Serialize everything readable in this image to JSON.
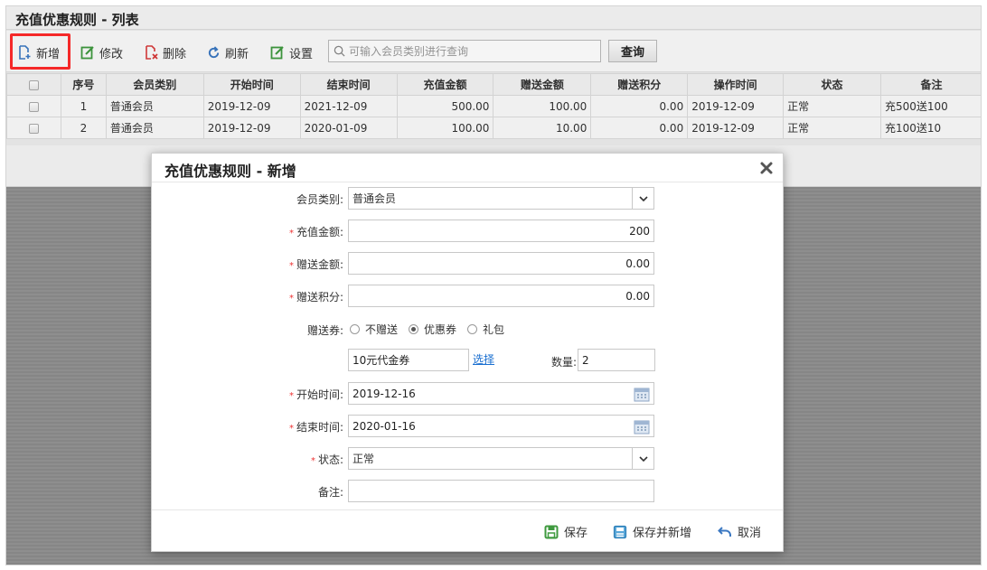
{
  "page_title": "充值优惠规则 - 列表",
  "toolbar": {
    "add_label": "新增",
    "edit_label": "修改",
    "delete_label": "删除",
    "refresh_label": "刷新",
    "settings_label": "设置",
    "search_placeholder": "可输入会员类别进行查询",
    "query_label": "查询"
  },
  "table": {
    "columns": [
      "序号",
      "会员类别",
      "开始时间",
      "结束时间",
      "充值金额",
      "赠送金额",
      "赠送积分",
      "操作时间",
      "状态",
      "备注"
    ],
    "rows": [
      [
        "1",
        "普通会员",
        "2019-12-09",
        "2021-12-09",
        "500.00",
        "100.00",
        "0.00",
        "2019-12-09",
        "正常",
        "充500送100"
      ],
      [
        "2",
        "普通会员",
        "2019-12-09",
        "2020-01-09",
        "100.00",
        "10.00",
        "0.00",
        "2019-12-09",
        "正常",
        "充100送10"
      ]
    ]
  },
  "dialog": {
    "title": "充值优惠规则 - 新增",
    "member_type_label": "会员类别:",
    "member_type_value": "普通会员",
    "recharge_label": "充值金额:",
    "recharge_value": "200",
    "gift_amount_label": "赠送金额:",
    "gift_amount_value": "0.00",
    "gift_points_label": "赠送积分:",
    "gift_points_value": "0.00",
    "gift_coupon_label": "赠送券:",
    "radio_none": "不赠送",
    "radio_coupon": "优惠券",
    "radio_gift": "礼包",
    "coupon_value": "10元代金券",
    "choose_label": "选择",
    "quantity_label": "数量:",
    "quantity_value": "2",
    "start_label": "开始时间:",
    "start_value": "2019-12-16",
    "end_label": "结束时间:",
    "end_value": "2020-01-16",
    "status_label": "状态:",
    "status_value": "正常",
    "remark_label": "备注:",
    "remark_value": "",
    "save_label": "保存",
    "save_new_label": "保存并新增",
    "cancel_label": "取消"
  },
  "colors": {
    "highlight": "#ff2a2a",
    "required": "#e33333",
    "link": "#1a6fd0",
    "icon_green": "#3f9a3f",
    "icon_blue": "#3b78c2",
    "icon_red": "#d83b3b"
  }
}
